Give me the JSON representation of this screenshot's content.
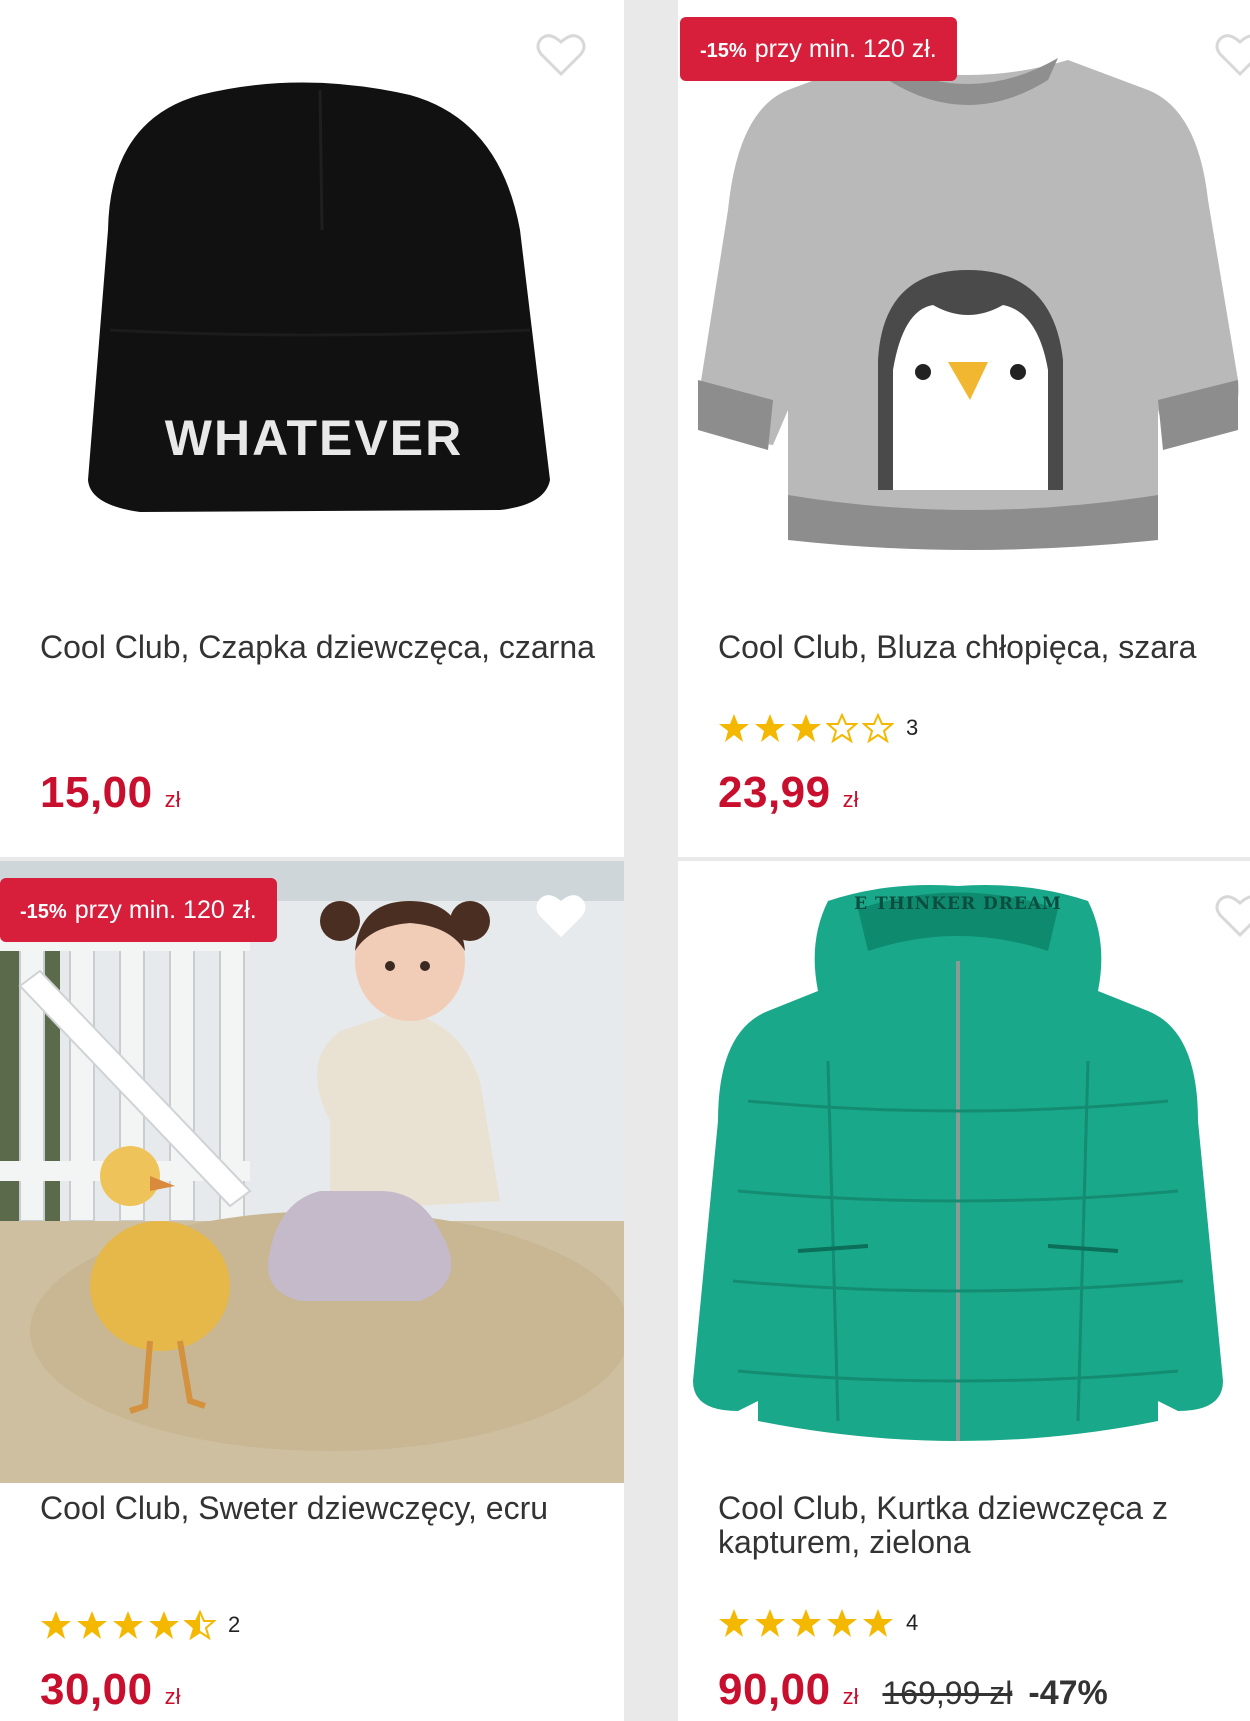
{
  "products": [
    {
      "title": "Cool Club, Czapka dziewczęca, czarna",
      "image_text": "WHATEVER",
      "price": "15,00",
      "currency": "zł"
    },
    {
      "promo_pct": "-15%",
      "promo_text": "przy min. 120 zł.",
      "title": "Cool Club, Bluza chłopięca, szara",
      "rating": 3,
      "rating_count": "3",
      "price": "23,99",
      "currency": "zł"
    },
    {
      "promo_pct": "-15%",
      "promo_text": "przy min. 120 zł.",
      "title": "Cool Club, Sweter dziewczęcy, ecru",
      "rating": 4.5,
      "rating_count": "2",
      "price": "30,00",
      "currency": "zł"
    },
    {
      "title": "Cool Club, Kurtka dziewczęca z kapturem, zielona",
      "image_text": "E THINKER DREAM",
      "rating": 5,
      "rating_count": "4",
      "price": "90,00",
      "currency": "zł",
      "old_price": "169,99 zł",
      "discount": "-47%"
    }
  ],
  "colors": {
    "accent": "#d71f3c",
    "price": "#c8102e",
    "star": "#f5b800"
  },
  "icons": {
    "favorite": "heart-outline-icon",
    "rating": "star-icon"
  }
}
